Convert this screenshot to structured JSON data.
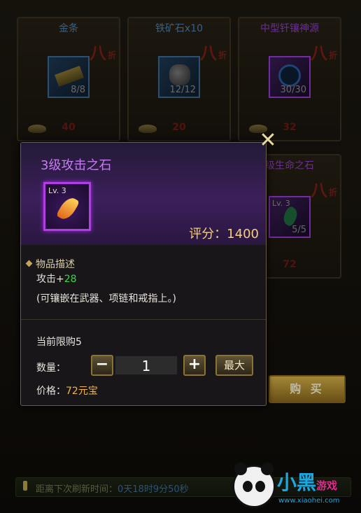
{
  "shop": {
    "cards": [
      {
        "title": "金条",
        "count": "8/8",
        "price": "40",
        "icon": "gold-bar-icon"
      },
      {
        "title": "铁矿石x10",
        "count": "12/12",
        "price": "20",
        "icon": "iron-ore-icon"
      },
      {
        "title": "中型钎镶神源",
        "count": "30/30",
        "price": "32",
        "icon": "compass-icon"
      },
      {
        "title": "级生命之石",
        "count": "5/5",
        "price": "72",
        "level": "Lv. 3",
        "icon": "gem-icon"
      }
    ],
    "discount_big": "八",
    "discount_small": "折",
    "buy_label": "购 买",
    "refresh_label": "距离下次刷新时间：",
    "refresh_time": "0天18时9分50秒"
  },
  "logo": {
    "title": "小黑",
    "subtitle": "游戏",
    "url": "www.xiaohei.com"
  },
  "dialog": {
    "title": "3级攻击之石",
    "level": "Lv. 3",
    "score": "评分：1400",
    "desc_head": "物品描述",
    "attr_label": "攻击+",
    "attr_value": "28",
    "note": "(可镶嵌在武器、项链和戒指上。)",
    "limit": "当前限购5",
    "qty_label": "数量：",
    "minus": "−",
    "qty_value": "1",
    "plus": "+",
    "max_label": "最大",
    "price_label": "价格：",
    "price_value": "72元宝",
    "close": "✕"
  },
  "colors": {
    "accent_purple": "#c67cf0",
    "gold": "#f6cd7a",
    "green_value": "#3fd44a"
  }
}
